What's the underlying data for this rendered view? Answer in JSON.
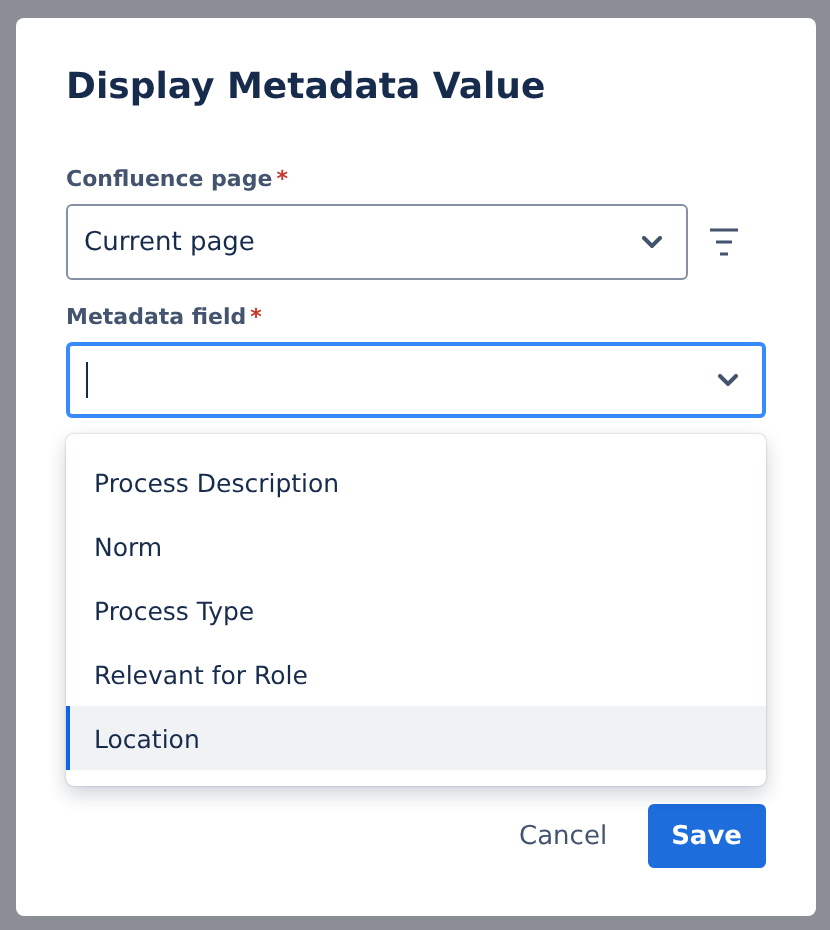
{
  "dialog": {
    "title": "Display Metadata Value"
  },
  "page_field": {
    "label": "Confluence page",
    "required_mark": "*",
    "value": "Current page"
  },
  "metadata_field": {
    "label": "Metadata field",
    "required_mark": "*",
    "focused": true,
    "expanded": true,
    "options": [
      {
        "label": "Process Description",
        "selected": false
      },
      {
        "label": "Norm",
        "selected": false
      },
      {
        "label": "Process Type",
        "selected": false
      },
      {
        "label": "Relevant for Role",
        "selected": false
      },
      {
        "label": "Location",
        "selected": true
      }
    ]
  },
  "buttons": [
    {
      "label": "Cancel",
      "kind": "subtle"
    },
    {
      "label": "Save",
      "kind": "primary"
    }
  ]
}
